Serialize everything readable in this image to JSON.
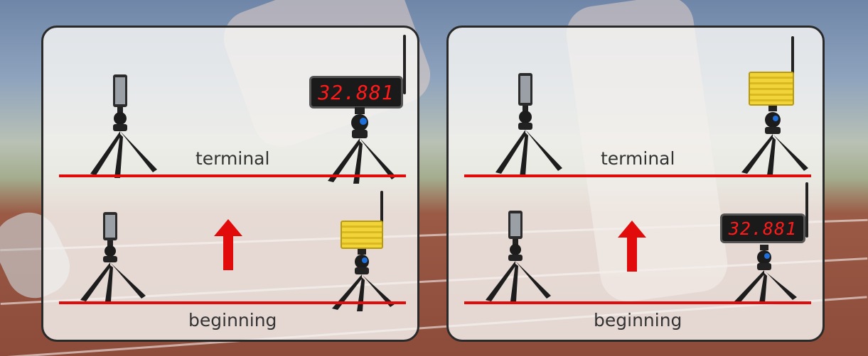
{
  "panels": [
    {
      "terminal_label": "terminal",
      "beginning_label": "beginning",
      "terminal_device": "timer-display",
      "beginning_device": "yellow-receiver",
      "timer_reading": "32.881"
    },
    {
      "terminal_label": "terminal",
      "beginning_label": "beginning",
      "terminal_device": "yellow-receiver",
      "beginning_device": "timer-display",
      "timer_reading": "32.881"
    }
  ],
  "colors": {
    "line": "#e10b0b",
    "arrow": "#e10b0b",
    "panel_border": "#2a2a2a",
    "timer_digits": "#ff1a1a",
    "receiver": "#f0d43a"
  }
}
